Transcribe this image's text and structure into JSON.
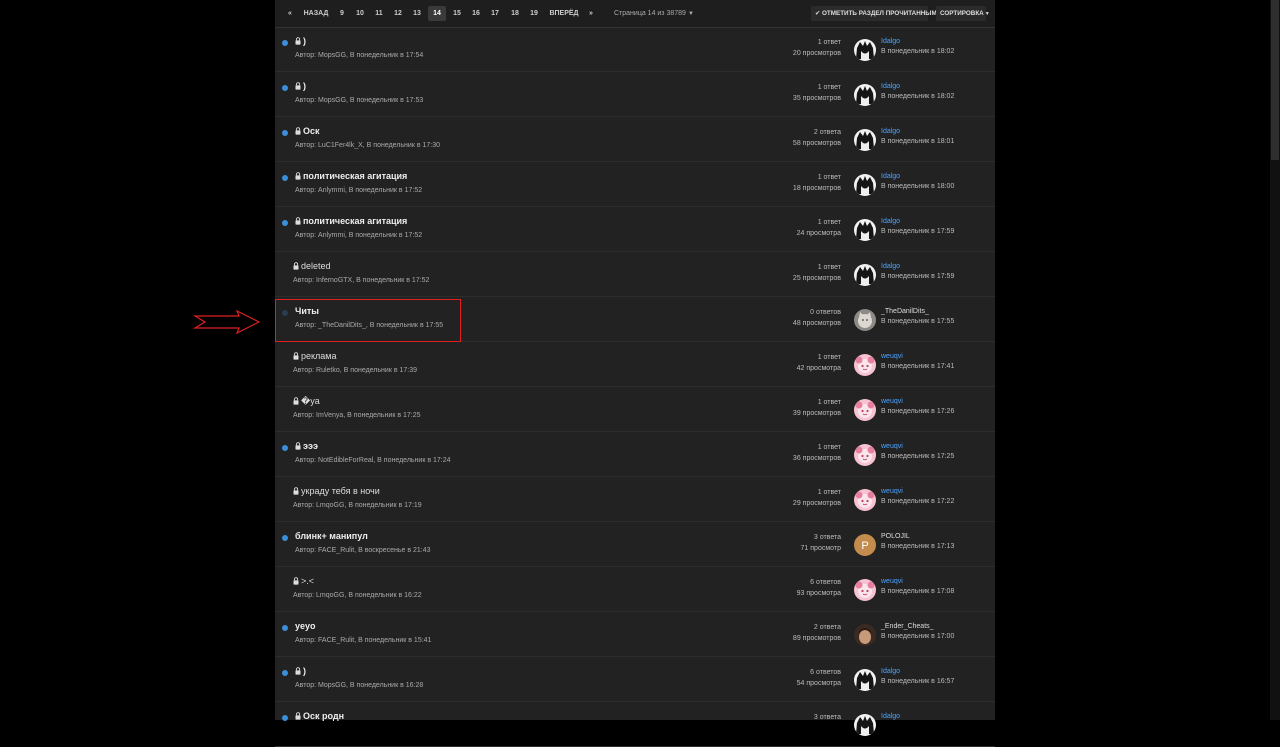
{
  "pagination": {
    "first": "«",
    "prev": "НАЗАД",
    "pages": [
      "9",
      "10",
      "11",
      "12",
      "13",
      "14",
      "15",
      "16",
      "17",
      "18",
      "19"
    ],
    "current": "14",
    "next": "ВПЕРЁД",
    "last": "»",
    "page_info": "Страница 14 из 38789",
    "mark_read": "✔ ОТМЕТИТЬ РАЗДЕЛ ПРОЧИТАННЫМ",
    "sort": "СОРТИРОВКА"
  },
  "colors": {
    "accent": "#3a8fd8",
    "link": "#4ba3ff",
    "highlight": "#e02020",
    "background": "#222222"
  },
  "topics": [
    {
      "title": ")",
      "locked": true,
      "unread": true,
      "meta": "Автор: MopsGG, В понедельник в 17:54",
      "replies": "1 ответ",
      "views": "20 просмотров",
      "last_user": "Idalgo",
      "last_time": "В понедельник в 18:02",
      "avatar": "anime"
    },
    {
      "title": ")",
      "locked": true,
      "unread": true,
      "meta": "Автор: MopsGG, В понедельник в 17:53",
      "replies": "1 ответ",
      "views": "35 просмотров",
      "last_user": "Idalgo",
      "last_time": "В понедельник в 18:02",
      "avatar": "anime"
    },
    {
      "title": "Оск",
      "locked": true,
      "unread": true,
      "meta": "Автор: LuC1Fer4lk_X, В понедельник в 17:30",
      "replies": "2 ответа",
      "views": "58 просмотров",
      "last_user": "Idalgo",
      "last_time": "В понедельник в 18:01",
      "avatar": "anime"
    },
    {
      "title": "политическая агитация",
      "locked": true,
      "unread": true,
      "meta": "Автор: Anlymmi, В понедельник в 17:52",
      "replies": "1 ответ",
      "views": "18 просмотров",
      "last_user": "Idalgo",
      "last_time": "В понедельник в 18:00",
      "avatar": "anime"
    },
    {
      "title": "политическая агитация",
      "locked": true,
      "unread": true,
      "meta": "Автор: Anlymmi, В понедельник в 17:52",
      "replies": "1 ответ",
      "views": "24 просмотра",
      "last_user": "Idalgo",
      "last_time": "В понедельник в 17:59",
      "avatar": "anime"
    },
    {
      "title": "deleted",
      "locked": true,
      "unread": false,
      "meta": "Автор: InfernoGTX, В понедельник в 17:52",
      "replies": "1 ответ",
      "views": "25 просмотров",
      "last_user": "Idalgo",
      "last_time": "В понедельник в 17:59",
      "avatar": "anime"
    },
    {
      "title": "Читы",
      "locked": false,
      "unread": true,
      "faint": true,
      "meta": "Автор: _TheDanilDits_, В понедельник в 17:55",
      "replies": "0 ответов",
      "views": "48 просмотров",
      "last_user": "_TheDanilDits_",
      "last_time": "В понедельник в 17:55",
      "avatar": "cat",
      "plain_user": true
    },
    {
      "title": "реклама",
      "locked": true,
      "unread": false,
      "meta": "Автор: Ruletko, В понедельник в 17:39",
      "replies": "1 ответ",
      "views": "42 просмотра",
      "last_user": "weuqvi",
      "last_time": "В понедельник в 17:41",
      "avatar": "pink"
    },
    {
      "title": "�ya",
      "locked": true,
      "unread": false,
      "meta": "Автор: ImVenya, В понедельник в 17:25",
      "replies": "1 ответ",
      "views": "39 просмотров",
      "last_user": "weuqvi",
      "last_time": "В понедельник в 17:26",
      "avatar": "pink"
    },
    {
      "title": "эээ",
      "locked": true,
      "unread": true,
      "meta": "Автор: NotEdibleForReal, В понедельник в 17:24",
      "replies": "1 ответ",
      "views": "36 просмотров",
      "last_user": "weuqvi",
      "last_time": "В понедельник в 17:25",
      "avatar": "pink"
    },
    {
      "title": "украду тебя в ночи",
      "locked": true,
      "unread": false,
      "meta": "Автор: LmqoGG, В понедельник в 17:19",
      "replies": "1 ответ",
      "views": "29 просмотров",
      "last_user": "weuqvi",
      "last_time": "В понедельник в 17:22",
      "avatar": "pink"
    },
    {
      "title": "блинк+ манипул",
      "locked": false,
      "unread": true,
      "meta": "Автор: FACE_Rulit, В воскресенье в 21:43",
      "replies": "3 ответа",
      "views": "71 просмотр",
      "last_user": "POLOJIL",
      "last_time": "В понедельник в 17:13",
      "avatar": "letter",
      "avatar_letter": "P",
      "plain_user": true
    },
    {
      "title": ">.<",
      "locked": true,
      "unread": false,
      "meta": "Автор: LmqoGG, В понедельник в 16:22",
      "replies": "6 ответов",
      "views": "93 просмотра",
      "last_user": "weuqvi",
      "last_time": "В понедельник в 17:08",
      "avatar": "pink"
    },
    {
      "title": "yeyo",
      "locked": false,
      "unread": true,
      "meta": "Автор: FACE_Rulit, В понедельник в 15:41",
      "replies": "2 ответа",
      "views": "89 просмотров",
      "last_user": "_Ender_Cheats_",
      "last_time": "В понедельник в 17:00",
      "avatar": "face",
      "plain_user": true
    },
    {
      "title": ")",
      "locked": true,
      "unread": true,
      "meta": "Автор: MopsGG, В понедельник в 16:28",
      "replies": "6 ответов",
      "views": "54 просмотра",
      "last_user": "Idalgo",
      "last_time": "В понедельник в 16:57",
      "avatar": "anime"
    },
    {
      "title": "Оск родн",
      "locked": true,
      "unread": true,
      "meta": "",
      "replies": "3 ответа",
      "views": "",
      "last_user": "Idalgo",
      "last_time": "",
      "avatar": "anime"
    }
  ]
}
